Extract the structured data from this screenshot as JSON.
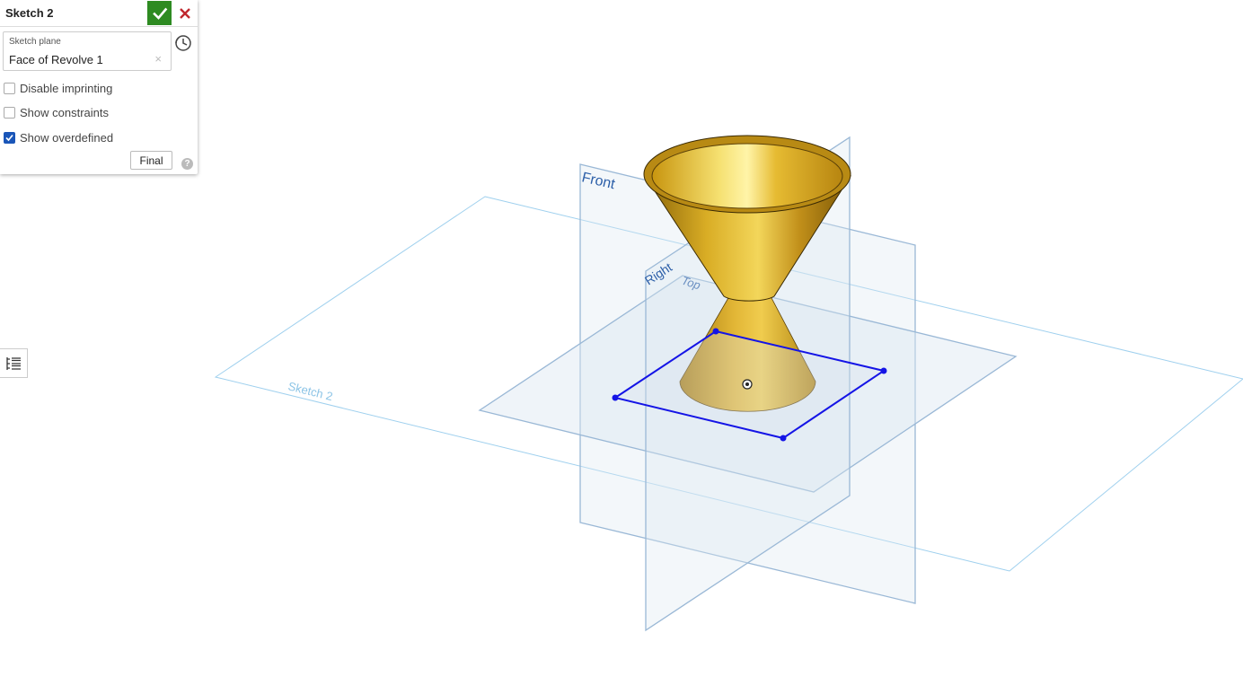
{
  "dialog": {
    "title": "Sketch 2",
    "sketch_plane_label": "Sketch plane",
    "sketch_plane_value": "Face of Revolve 1",
    "clear_icon": "×",
    "options": [
      {
        "label": "Disable imprinting",
        "checked": false
      },
      {
        "label": "Show constraints",
        "checked": false
      },
      {
        "label": "Show overdefined",
        "checked": true
      }
    ],
    "final_label": "Final",
    "help_label": "?"
  },
  "viewport": {
    "planes": {
      "front": "Front",
      "right": "Right",
      "top": "Top",
      "sketch": "Sketch 2"
    },
    "part_color": "#c89a1a",
    "sketch_color": "#1414e6",
    "plane_color": "#8fb4d9"
  },
  "icons": {
    "confirm": "checkmark-icon",
    "cancel": "close-icon",
    "history": "clock-icon",
    "list": "feature-list-icon"
  }
}
